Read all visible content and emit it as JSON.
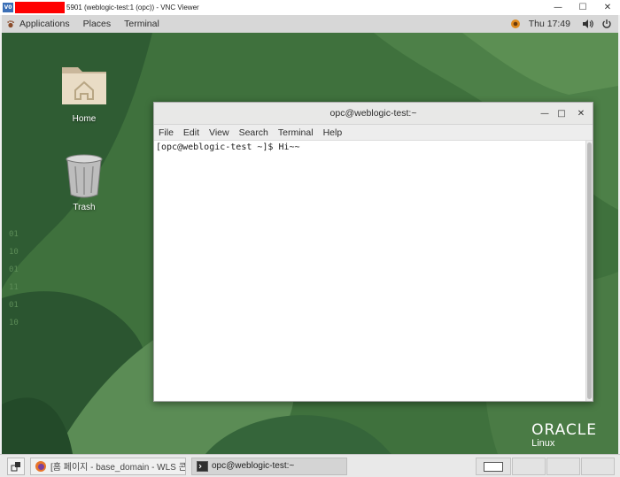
{
  "vnc": {
    "logo_text": "V0",
    "title": "5901 (weblogic-test:1 (opc)) - VNC Viewer",
    "minimize": "—",
    "maximize": "☐",
    "close": "✕"
  },
  "topbar": {
    "applications": "Applications",
    "places": "Places",
    "terminal": "Terminal",
    "clock": "Thu 17:49"
  },
  "desktop": {
    "icons": [
      {
        "label": "Home",
        "icon": "home-folder-icon"
      },
      {
        "label": "Trash",
        "icon": "trash-icon"
      }
    ],
    "brand": {
      "word": "ORACLE",
      "sub": "Linux"
    }
  },
  "terminal": {
    "title": "opc@weblogic-test:~",
    "menu": [
      "File",
      "Edit",
      "View",
      "Search",
      "Terminal",
      "Help"
    ],
    "lines": [
      "[opc@weblogic-test ~]$ Hi~~"
    ],
    "minimize": "—",
    "maximize": "□",
    "close": "✕"
  },
  "taskbar": {
    "items": [
      {
        "label": "[홈 페이지 - base_domain - WLS 콘…",
        "icon": "firefox-icon",
        "active": false
      },
      {
        "label": "opc@weblogic-test:~",
        "icon": "terminal-icon",
        "active": true
      }
    ],
    "workspaces": 4
  },
  "colors": {
    "desktop_bg": "#3e6f3c",
    "topbar_bg": "#d7d7d7",
    "vnc_redacted": "#ff0000"
  }
}
